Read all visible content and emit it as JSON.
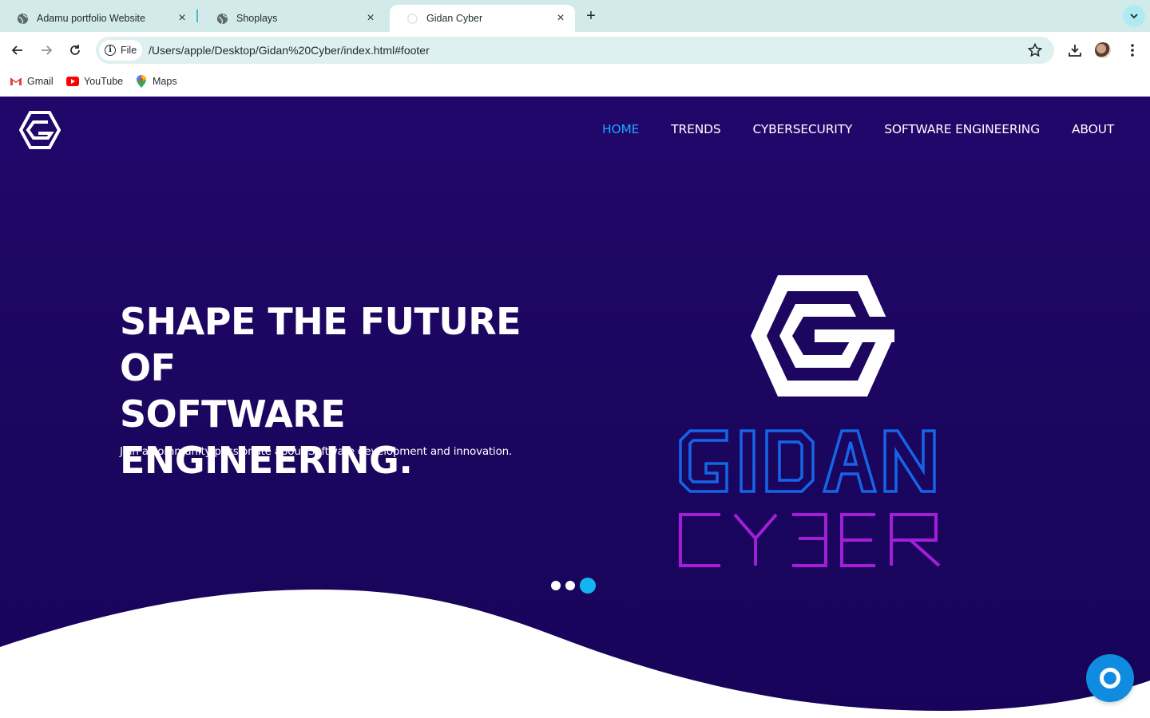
{
  "browser": {
    "tabs": [
      {
        "title": "Adamu portfolio Website",
        "icon": "globe-icon"
      },
      {
        "title": "Shoplays",
        "icon": "globe-icon"
      },
      {
        "title": "Gidan Cyber",
        "icon": "loading-icon",
        "active": true
      }
    ],
    "new_tab": "+",
    "close_glyph": "×",
    "address": {
      "chip": "File",
      "url": "/Users/apple/Desktop/Gidan%20Cyber/index.html#footer"
    },
    "bookmarks": [
      {
        "label": "Gmail",
        "icon": "gmail-icon"
      },
      {
        "label": "YouTube",
        "icon": "youtube-icon"
      },
      {
        "label": "Maps",
        "icon": "maps-icon"
      }
    ]
  },
  "site": {
    "nav": [
      {
        "label": "HOME",
        "active": true
      },
      {
        "label": "TRENDS"
      },
      {
        "label": "CYBERSECURITY"
      },
      {
        "label": "SOFTWARE ENGINEERING"
      },
      {
        "label": "ABOUT"
      }
    ],
    "hero": {
      "title_lines": [
        "SHAPE THE FUTURE OF",
        "SOFTWARE",
        "ENGINEERING."
      ],
      "subtitle": "Join a community passionate about Software development and innovation.",
      "logo_words": [
        "GIDAN",
        "CYBER"
      ]
    },
    "slider": {
      "count": 3,
      "active_index": 3
    },
    "colors": {
      "background": "#1c0660",
      "nav_active": "#1aa7ff",
      "accent_blue": "#1565e8",
      "accent_magenta": "#a41ed8",
      "chat_button": "#0f8ce0"
    }
  }
}
